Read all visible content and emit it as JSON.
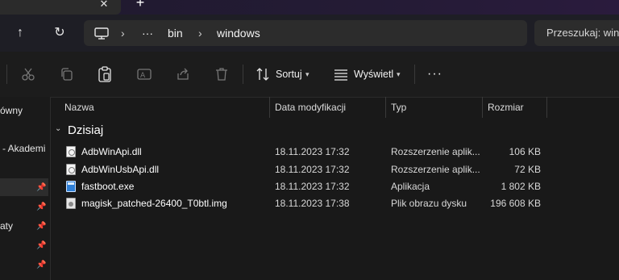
{
  "tabs": {
    "close_glyph": "✕",
    "new_glyph": "+"
  },
  "nav": {
    "up_icon": "↑",
    "refresh_icon": "↻",
    "breadcrumb": [
      "bin",
      "windows"
    ],
    "overflow": "···",
    "search_placeholder": "Przeszukaj: windows"
  },
  "toolbar": {
    "sort_label": "Sortuj",
    "view_label": "Wyświetl",
    "more_label": "···"
  },
  "sidebar": {
    "items": [
      {
        "label": "ówny"
      },
      {
        "label": "- Akademi"
      },
      {
        "label": ""
      },
      {
        "label": ""
      },
      {
        "label": "aty"
      },
      {
        "label": ""
      },
      {
        "label": ""
      }
    ]
  },
  "columns": [
    "Nazwa",
    "Data modyfikacji",
    "Typ",
    "Rozmiar"
  ],
  "group": {
    "label": "Dzisiaj"
  },
  "files": [
    {
      "name": "AdbWinApi.dll",
      "date": "18.11.2023 17:32",
      "type": "Rozszerzenie aplik...",
      "size": "106 KB",
      "icon": "dll"
    },
    {
      "name": "AdbWinUsbApi.dll",
      "date": "18.11.2023 17:32",
      "type": "Rozszerzenie aplik...",
      "size": "72 KB",
      "icon": "dll"
    },
    {
      "name": "fastboot.exe",
      "date": "18.11.2023 17:32",
      "type": "Aplikacja",
      "size": "1 802 KB",
      "icon": "exe"
    },
    {
      "name": "magisk_patched-26400_T0btl.img",
      "date": "18.11.2023 17:38",
      "type": "Plik obrazu dysku",
      "size": "196 608 KB",
      "icon": "img"
    }
  ]
}
